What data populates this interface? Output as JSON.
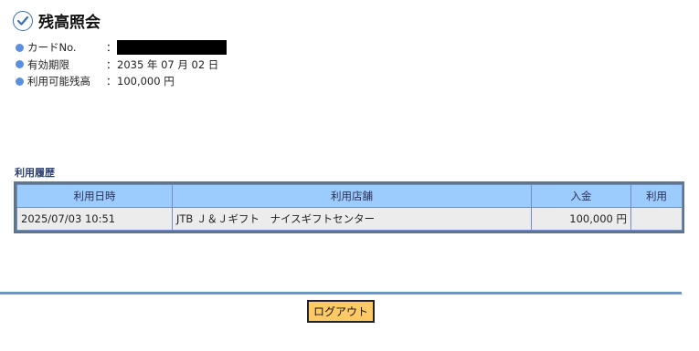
{
  "page": {
    "title": "残高照会"
  },
  "card_info": [
    {
      "label": "カードNo.",
      "separator": "：",
      "value": ""
    },
    {
      "label": "有効期限",
      "separator": "：",
      "value": "2035 年 07 月 02 日"
    },
    {
      "label": "利用可能残高",
      "separator": "：",
      "value": "100,000 円"
    }
  ],
  "history": {
    "heading": "利用履歴",
    "columns": [
      "利用日時",
      "利用店舗",
      "入金",
      "利用"
    ],
    "rows": [
      [
        "2025/07/03 10:51",
        "JTB Ｊ＆Ｊギフト　ナイスギフトセンター",
        "100,000 円",
        ""
      ]
    ]
  },
  "logout_label": "ログアウト",
  "colors": {
    "header_bg": "#9ccbfd",
    "row_bg": "#ececec",
    "table_border": "#5e748f",
    "bullet": "#5b8fe0",
    "divider": "#6f95c5",
    "logout_bg": "#ffca66"
  }
}
